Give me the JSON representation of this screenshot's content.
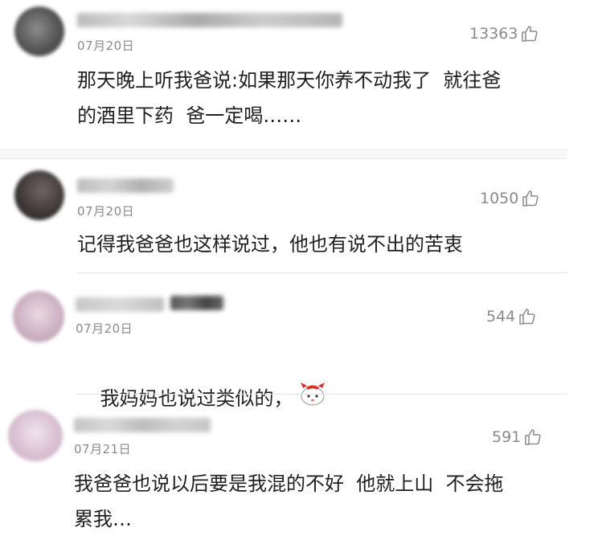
{
  "comments": [
    {
      "date": "07月20日",
      "likes": "13363",
      "text": "那天晚上听我爸说:如果那天你养不动我了  就往爸\n的酒里下药  爸一定喝……",
      "avatar_color": "#5a5a5a"
    },
    {
      "date": "07月20日",
      "likes": "1050",
      "text": "记得我爸爸也这样说过，他也有说不出的苦衷",
      "avatar_color": "#4a4442"
    },
    {
      "date": "07月20日",
      "likes": "544",
      "text": "我妈妈也说过类似的，",
      "avatar_color": "#c9aebd",
      "emoji": "cat-emoji"
    },
    {
      "date": "07月21日",
      "likes": "591",
      "text": "我爸爸也说以后要是我混的不好  他就上山  不会拖\n累我…",
      "avatar_color": "#d7bdd0"
    }
  ],
  "icons": {
    "like": "thumbs-up-icon"
  }
}
